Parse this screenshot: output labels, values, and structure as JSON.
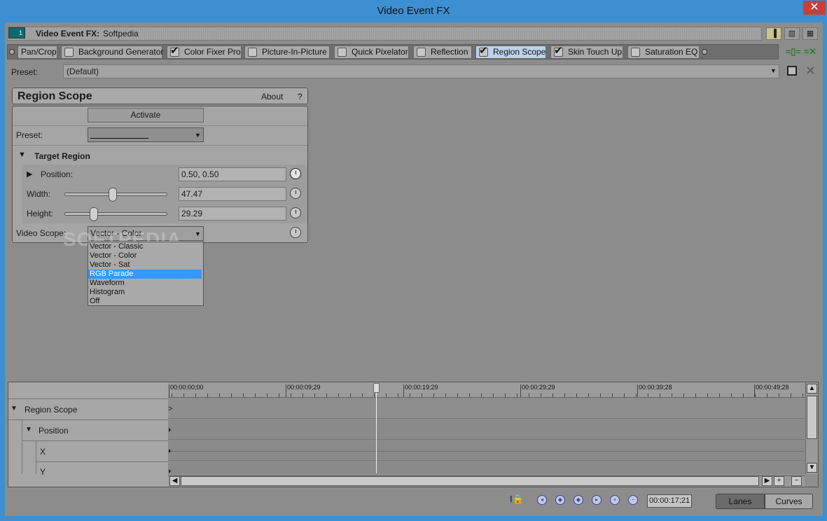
{
  "window": {
    "title": "Video Event FX",
    "close_glyph": "✕"
  },
  "header": {
    "track_num": "1",
    "label": "Video Event FX:",
    "value": "Softpedia"
  },
  "chain": {
    "plugins": [
      {
        "label": "Pan/Crop",
        "checked": false,
        "active": false,
        "has_checkbox": false
      },
      {
        "label": "Background Generator",
        "checked": false,
        "active": false,
        "has_checkbox": true
      },
      {
        "label": "Color Fixer Pro",
        "checked": true,
        "active": false,
        "has_checkbox": true
      },
      {
        "label": "Picture-In-Picture",
        "checked": false,
        "active": false,
        "has_checkbox": true
      },
      {
        "label": "Quick Pixelator",
        "checked": false,
        "active": false,
        "has_checkbox": true
      },
      {
        "label": "Reflection",
        "checked": false,
        "active": false,
        "has_checkbox": true
      },
      {
        "label": "Region Scope",
        "checked": true,
        "active": true,
        "has_checkbox": true
      },
      {
        "label": "Skin Touch Up",
        "checked": true,
        "active": false,
        "has_checkbox": true
      },
      {
        "label": "Saturation EQ",
        "checked": false,
        "active": false,
        "has_checkbox": true
      }
    ]
  },
  "preset": {
    "label": "Preset:",
    "value": "(Default)"
  },
  "region_scope": {
    "title": "Region Scope",
    "about": "About",
    "help": "?",
    "activate": "Activate",
    "preset_label": "Preset:",
    "section": "Target Region",
    "position": {
      "label": "Position:",
      "value": "0.50, 0.50"
    },
    "width": {
      "label": "Width:",
      "value": "47.47",
      "slider_fraction": 0.47
    },
    "height": {
      "label": "Height:",
      "value": "29.29",
      "slider_fraction": 0.29
    },
    "video_scope": {
      "label": "Video Scope:",
      "value": "Vector - Color",
      "options": [
        "Vector - Classic",
        "Vector - Color",
        "Vector - Sat",
        "RGB Parade",
        "Waveform",
        "Histogram",
        "Off"
      ],
      "highlighted": "RGB Parade"
    }
  },
  "watermark": "SOFTPEDIA",
  "timeline": {
    "ruler": [
      "00:00:00;00",
      "00:00:09;29",
      "00:00:19;29",
      "00:00:29;29",
      "00:00:39;28",
      "00:00:49;28"
    ],
    "tracks": [
      "Region Scope",
      "Position",
      "X",
      "Y"
    ]
  },
  "footer": {
    "timecode": "00:00:17;21",
    "lanes": "Lanes",
    "curves": "Curves"
  },
  "colors": {
    "accent": "#3c8fd1",
    "selection": "#3399ff",
    "background": "#8c8c8c"
  }
}
